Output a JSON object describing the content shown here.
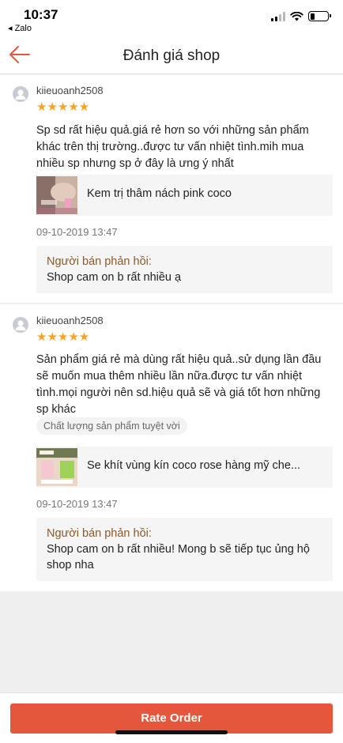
{
  "status_bar": {
    "time": "10:37",
    "back_app": "◂ Zalo",
    "battery_level": 0.25
  },
  "header": {
    "title": "Đánh giá shop",
    "back_icon": "arrow-left-icon",
    "accent_color": "#e5573d"
  },
  "reviews": [
    {
      "username": "kiieuoanh2508",
      "rating": 5,
      "stars": "★★★★★",
      "text": "Sp sd rất hiệu quả.giá rẻ hơn so với những sản phẩm khác trên thị trường..được tư vấn nhiệt tình.mih mua nhiều sp nhưng sp ở đây là ưng ý nhất",
      "tag": "",
      "product_name": "Kem trị thâm nách pink coco",
      "date": "09-10-2019 13:47",
      "reply_label": "Người bán phản hồi:",
      "reply_text": "Shop cam on b rất nhiều ạ"
    },
    {
      "username": "kiieuoanh2508",
      "rating": 5,
      "stars": "★★★★★",
      "text": "Sản phẩm giá rẻ mà dùng rất hiệu quả..sử dụng lần đầu sẽ muốn mua thêm nhiều  lần nữa.được tư vấn nhiệt tình.mọi người nên sd.hiệu quả sẽ và giá tốt hơn những sp khác",
      "tag": "Chất lượng sản phẩm tuyệt vời",
      "product_name": "Se khít vùng kín coco rose hàng mỹ che...",
      "date": "09-10-2019 13:47",
      "reply_label": "Người bán phản hồi:",
      "reply_text": "Shop cam on b rất nhiều! Mong b sẽ tiếp tục ủng hộ shop nha"
    }
  ],
  "footer": {
    "rate_button": "Rate Order"
  }
}
